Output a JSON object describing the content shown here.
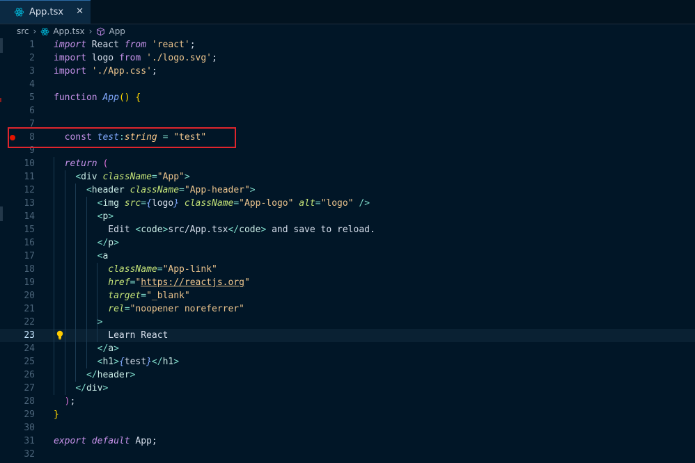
{
  "tab": {
    "label": "App.tsx",
    "icon": "react-icon",
    "close_icon": "close-icon"
  },
  "breadcrumb": {
    "items": [
      "src",
      "App.tsx",
      "App"
    ]
  },
  "editor": {
    "current_line": "23",
    "lines": [
      {
        "n": "1",
        "t": [
          [
            "kwi",
            "import"
          ],
          [
            "txt",
            " React "
          ],
          [
            "kwi",
            "from"
          ],
          [
            "txt",
            " "
          ],
          [
            "str",
            "'react'"
          ],
          [
            "txt",
            ";"
          ]
        ]
      },
      {
        "n": "2",
        "t": [
          [
            "kw",
            "import"
          ],
          [
            "txt",
            " logo "
          ],
          [
            "kw",
            "from"
          ],
          [
            "txt",
            " "
          ],
          [
            "str",
            "'./logo.svg'"
          ],
          [
            "txt",
            ";"
          ]
        ]
      },
      {
        "n": "3",
        "t": [
          [
            "kw",
            "import"
          ],
          [
            "txt",
            " "
          ],
          [
            "str",
            "'./App.css'"
          ],
          [
            "txt",
            ";"
          ]
        ]
      },
      {
        "n": "4",
        "t": []
      },
      {
        "n": "5",
        "t": [
          [
            "kw",
            "function"
          ],
          [
            "txt",
            " "
          ],
          [
            "fn",
            "App"
          ],
          [
            "paren",
            "()"
          ],
          [
            "txt",
            " "
          ],
          [
            "paren",
            "{"
          ]
        ]
      },
      {
        "n": "6",
        "t": []
      },
      {
        "n": "7",
        "t": []
      },
      {
        "n": "8",
        "t": [
          [
            "txt",
            "  "
          ],
          [
            "kw",
            "const"
          ],
          [
            "txt",
            " "
          ],
          [
            "var",
            "test"
          ],
          [
            "punc",
            ":"
          ],
          [
            "type",
            "string"
          ],
          [
            "txt",
            " "
          ],
          [
            "punc",
            "="
          ],
          [
            "txt",
            " "
          ],
          [
            "str",
            "\"test\""
          ]
        ]
      },
      {
        "n": "9",
        "t": []
      },
      {
        "n": "10",
        "t": [
          [
            "txt",
            "  "
          ],
          [
            "kwi",
            "return"
          ],
          [
            "txt",
            " "
          ],
          [
            "brace",
            "("
          ]
        ]
      },
      {
        "n": "11",
        "t": [
          [
            "txt",
            "    "
          ],
          [
            "punc",
            "<"
          ],
          [
            "tag",
            "div"
          ],
          [
            "txt",
            " "
          ],
          [
            "attr",
            "className"
          ],
          [
            "punc",
            "="
          ],
          [
            "str",
            "\"App\""
          ],
          [
            "punc",
            ">"
          ]
        ]
      },
      {
        "n": "12",
        "t": [
          [
            "txt",
            "      "
          ],
          [
            "punc",
            "<"
          ],
          [
            "tag",
            "header"
          ],
          [
            "txt",
            " "
          ],
          [
            "attr",
            "className"
          ],
          [
            "punc",
            "="
          ],
          [
            "str",
            "\"App-header\""
          ],
          [
            "punc",
            ">"
          ]
        ]
      },
      {
        "n": "13",
        "t": [
          [
            "txt",
            "        "
          ],
          [
            "punc",
            "<"
          ],
          [
            "tag",
            "img"
          ],
          [
            "txt",
            " "
          ],
          [
            "attr",
            "src"
          ],
          [
            "punc",
            "="
          ],
          [
            "fn",
            "{"
          ],
          [
            "txt",
            "logo"
          ],
          [
            "fn",
            "}"
          ],
          [
            "txt",
            " "
          ],
          [
            "attr",
            "className"
          ],
          [
            "punc",
            "="
          ],
          [
            "str",
            "\"App-logo\""
          ],
          [
            "txt",
            " "
          ],
          [
            "attr",
            "alt"
          ],
          [
            "punc",
            "="
          ],
          [
            "str",
            "\"logo\""
          ],
          [
            "txt",
            " "
          ],
          [
            "punc",
            "/>"
          ]
        ]
      },
      {
        "n": "14",
        "t": [
          [
            "txt",
            "        "
          ],
          [
            "punc",
            "<"
          ],
          [
            "tag",
            "p"
          ],
          [
            "punc",
            ">"
          ]
        ]
      },
      {
        "n": "15",
        "t": [
          [
            "txt",
            "          Edit "
          ],
          [
            "punc",
            "<"
          ],
          [
            "tag",
            "code"
          ],
          [
            "punc",
            ">"
          ],
          [
            "txt",
            "src/App.tsx"
          ],
          [
            "punc",
            "</"
          ],
          [
            "tag",
            "code"
          ],
          [
            "punc",
            ">"
          ],
          [
            "txt",
            " and save to reload."
          ]
        ]
      },
      {
        "n": "16",
        "t": [
          [
            "txt",
            "        "
          ],
          [
            "punc",
            "</"
          ],
          [
            "tag",
            "p"
          ],
          [
            "punc",
            ">"
          ]
        ]
      },
      {
        "n": "17",
        "t": [
          [
            "txt",
            "        "
          ],
          [
            "punc",
            "<"
          ],
          [
            "tag",
            "a"
          ]
        ]
      },
      {
        "n": "18",
        "t": [
          [
            "txt",
            "          "
          ],
          [
            "attr",
            "className"
          ],
          [
            "punc",
            "="
          ],
          [
            "str",
            "\"App-link\""
          ]
        ]
      },
      {
        "n": "19",
        "t": [
          [
            "txt",
            "          "
          ],
          [
            "attr",
            "href"
          ],
          [
            "punc",
            "="
          ],
          [
            "str",
            "\""
          ],
          [
            "link",
            "https://reactjs.org"
          ],
          [
            "str",
            "\""
          ]
        ]
      },
      {
        "n": "20",
        "t": [
          [
            "txt",
            "          "
          ],
          [
            "attr",
            "target"
          ],
          [
            "punc",
            "="
          ],
          [
            "str",
            "\"_blank\""
          ]
        ]
      },
      {
        "n": "21",
        "t": [
          [
            "txt",
            "          "
          ],
          [
            "attr",
            "rel"
          ],
          [
            "punc",
            "="
          ],
          [
            "str",
            "\"noopener noreferrer\""
          ]
        ]
      },
      {
        "n": "22",
        "t": [
          [
            "txt",
            "        "
          ],
          [
            "punc",
            ">"
          ]
        ]
      },
      {
        "n": "23",
        "t": [
          [
            "txt",
            "          Learn React"
          ]
        ]
      },
      {
        "n": "24",
        "t": [
          [
            "txt",
            "        "
          ],
          [
            "punc",
            "</"
          ],
          [
            "tag",
            "a"
          ],
          [
            "punc",
            ">"
          ]
        ]
      },
      {
        "n": "25",
        "t": [
          [
            "txt",
            "        "
          ],
          [
            "punc",
            "<"
          ],
          [
            "tag",
            "h1"
          ],
          [
            "punc",
            ">"
          ],
          [
            "fn",
            "{"
          ],
          [
            "txt",
            "test"
          ],
          [
            "fn",
            "}"
          ],
          [
            "punc",
            "</"
          ],
          [
            "tag",
            "h1"
          ],
          [
            "punc",
            ">"
          ]
        ]
      },
      {
        "n": "26",
        "t": [
          [
            "txt",
            "      "
          ],
          [
            "punc",
            "</"
          ],
          [
            "tag",
            "header"
          ],
          [
            "punc",
            ">"
          ]
        ]
      },
      {
        "n": "27",
        "t": [
          [
            "txt",
            "    "
          ],
          [
            "punc",
            "</"
          ],
          [
            "tag",
            "div"
          ],
          [
            "punc",
            ">"
          ]
        ]
      },
      {
        "n": "28",
        "t": [
          [
            "txt",
            "  "
          ],
          [
            "brace",
            ")"
          ],
          [
            "txt",
            ";"
          ]
        ]
      },
      {
        "n": "29",
        "t": [
          [
            "paren",
            "}"
          ]
        ]
      },
      {
        "n": "30",
        "t": []
      },
      {
        "n": "31",
        "t": [
          [
            "kwi",
            "export"
          ],
          [
            "txt",
            " "
          ],
          [
            "kwi",
            "default"
          ],
          [
            "txt",
            " App;"
          ]
        ]
      },
      {
        "n": "32",
        "t": []
      }
    ]
  },
  "colors": {
    "background": "#011627",
    "breakpoint": "#e51400",
    "highlight_box": "#e0252d"
  }
}
